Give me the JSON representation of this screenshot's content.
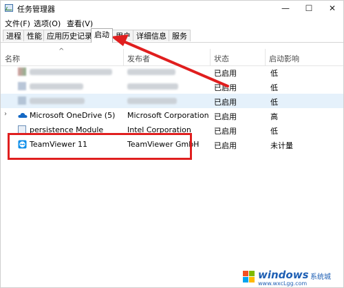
{
  "window": {
    "title": "任务管理器",
    "minimize": "—",
    "maximize": "☐",
    "close": "✕"
  },
  "menu": [
    "文件(F)",
    "选项(O)",
    "查看(V)"
  ],
  "tabs": [
    {
      "label": "进程",
      "active": false
    },
    {
      "label": "性能",
      "active": false
    },
    {
      "label": "应用历史记录",
      "active": false
    },
    {
      "label": "启动",
      "active": true
    },
    {
      "label": "用户",
      "active": false
    },
    {
      "label": "详细信息",
      "active": false
    },
    {
      "label": "服务",
      "active": false
    }
  ],
  "columns": {
    "name": "名称",
    "publisher": "发布者",
    "status": "状态",
    "impact": "启动影响",
    "sort_glyph": "^"
  },
  "rows": [
    {
      "name": "",
      "publisher": "",
      "status": "已启用",
      "impact": "低",
      "blurred": true,
      "icon": "app-icon"
    },
    {
      "name": "",
      "publisher": "",
      "status": "已启用",
      "impact": "低",
      "blurred": true,
      "icon": "app-icon"
    },
    {
      "name": "",
      "publisher": "",
      "status": "已启用",
      "impact": "低",
      "blurred": true,
      "icon": "app-icon",
      "highlighted": true
    },
    {
      "name": "Microsoft OneDrive (5)",
      "publisher": "Microsoft Corporation",
      "status": "已启用",
      "impact": "高",
      "expander": "›",
      "icon": "onedrive-icon"
    },
    {
      "name": "persistence Module",
      "publisher": "Intel Corporation",
      "status": "已启用",
      "impact": "低",
      "icon": "intel-module-icon"
    },
    {
      "name": "TeamViewer 11",
      "publisher": "TeamViewer GmbH",
      "status": "已启用",
      "impact": "未计量",
      "icon": "teamviewer-icon"
    }
  ],
  "watermark": {
    "brand": "windows",
    "sub": "系统城",
    "url": "www.wxcLgg.com"
  },
  "colors": {
    "annotation_red": "#e01e1e",
    "highlight_row": "#e5f1fb",
    "brand_blue": "#1e5fb4"
  }
}
